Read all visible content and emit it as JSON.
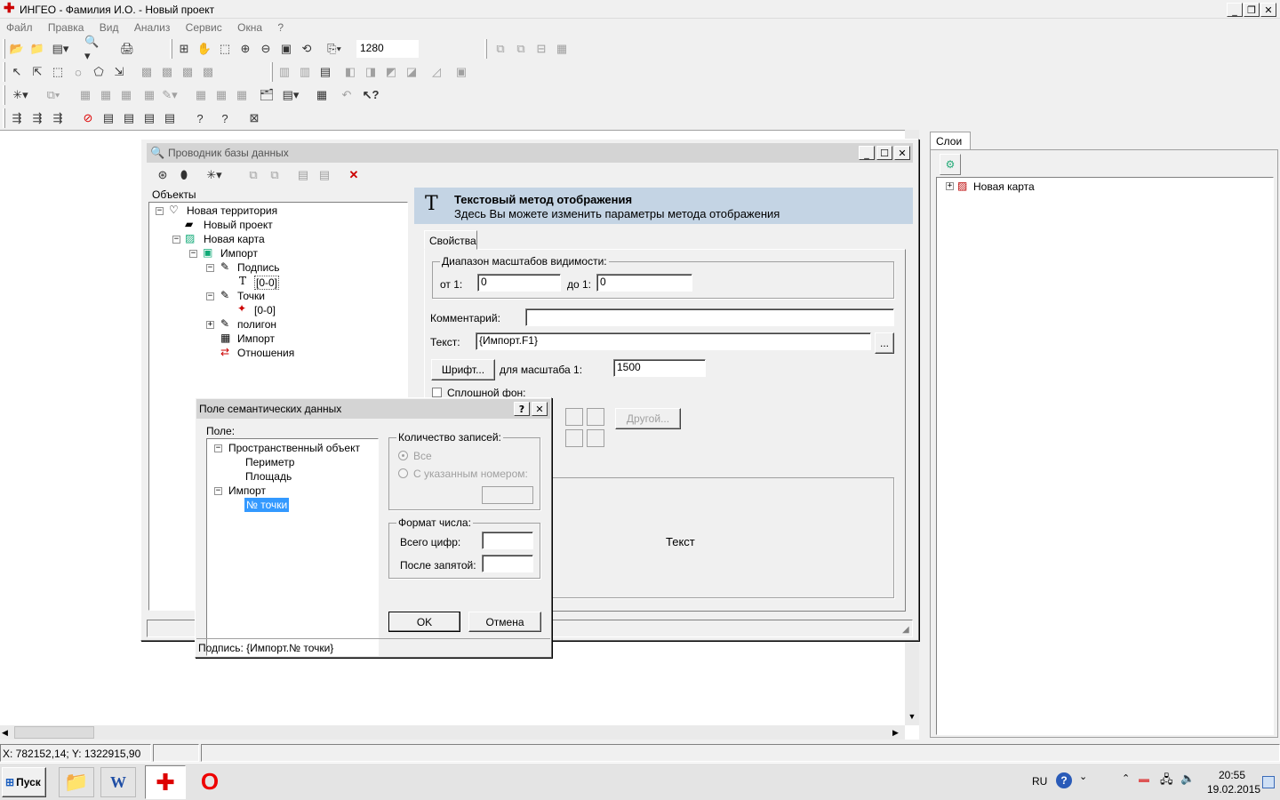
{
  "app": {
    "title": "ИНГЕО - Фамилия И.О. - Новый проект",
    "menu": [
      "Файл",
      "Правка",
      "Вид",
      "Анализ",
      "Сервис",
      "Окна",
      "?"
    ],
    "scale_value": "1280"
  },
  "db_explorer": {
    "title": "Проводник базы данных",
    "objects_header": "Объекты",
    "tree": [
      {
        "label": "Новая территория",
        "icon": "territory-icon"
      },
      {
        "label": "Новый проект",
        "icon": "project-icon"
      },
      {
        "label": "Новая карта",
        "icon": "map-icon"
      },
      {
        "label": "Импорт",
        "icon": "layer-icon"
      },
      {
        "label": "Подпись",
        "icon": "pencil-icon"
      },
      {
        "label": "[0-0]",
        "icon": "text-style-icon"
      },
      {
        "label": "Точки",
        "icon": "pencil-icon"
      },
      {
        "label": "[0-0]",
        "icon": "point-style-icon"
      },
      {
        "label": "полигон",
        "icon": "pencil-icon"
      },
      {
        "label": "Импорт",
        "icon": "table-icon"
      },
      {
        "label": "Отношения",
        "icon": "relations-icon"
      }
    ],
    "panel": {
      "icon_glyph": "T",
      "title": "Текстовый метод отображения",
      "subtitle": "Здесь Вы можете изменить параметры метода отображения",
      "tab": "Свойства",
      "scale_group": "Диапазон масштабов видимости:",
      "from_label": "от 1:",
      "from_value": "0",
      "to_label": "до 1:",
      "to_value": "0",
      "comment_label": "Комментарий:",
      "comment_value": "",
      "text_label": "Текст:",
      "text_value": "{Импорт.F1}",
      "browse": "...",
      "font_button": "Шрифт...",
      "font_scale_label": "для масштаба 1:",
      "font_scale_value": "1500",
      "solid_bg_label": "Сплошной фон:",
      "other_button": "Другой...",
      "preview_text": "Текст"
    }
  },
  "layers_panel": {
    "tab": "Слои",
    "tree_item": "Новая карта"
  },
  "dialog": {
    "title": "Поле семантических данных",
    "help": "?",
    "field_label": "Поле:",
    "tree": [
      {
        "label": "Пространственный объект",
        "level": 0,
        "expanded": true
      },
      {
        "label": "Периметр",
        "level": 1
      },
      {
        "label": "Площадь",
        "level": 1
      },
      {
        "label": "Импорт",
        "level": 0,
        "expanded": true
      },
      {
        "label": "№ точки",
        "level": 1,
        "selected": true
      }
    ],
    "records_group": "Количество записей:",
    "radio_all": "Все",
    "radio_numbered": "С указанным номером:",
    "format_group": "Формат числа:",
    "total_digits_label": "Всего цифр:",
    "after_comma_label": "После запятой:",
    "ok": "OK",
    "cancel": "Отмена",
    "status": "Подпись: {Импорт.№ точки}"
  },
  "status_bar": {
    "coords": "X: 782152,14; Y: 1322915,90"
  },
  "taskbar": {
    "start": "Пуск",
    "lang": "RU",
    "time": "20:55",
    "date": "19.02.2015"
  }
}
